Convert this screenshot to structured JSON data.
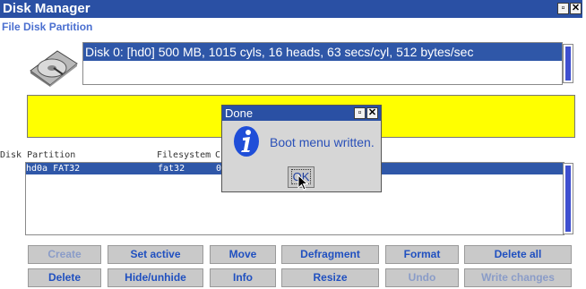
{
  "app": {
    "title": "Disk Manager",
    "menu_label": "File Disk Partition"
  },
  "disk": {
    "summary": "Disk 0: [hd0] 500 MB, 1015 cyls, 16 heads, 63 secs/cyl, 512 bytes/sec"
  },
  "partitions": {
    "headers": [
      "Disk Partition",
      "Filesystem",
      "C"
    ],
    "rows": [
      {
        "partition": "hd0a FAT32",
        "filesystem": "fat32",
        "c": "0"
      }
    ]
  },
  "buttons_row1": {
    "create": "Create",
    "set_active": "Set active",
    "move": "Move",
    "defragment": "Defragment",
    "format": "Format",
    "delete_all": "Delete all"
  },
  "buttons_row2": {
    "delete": "Delete",
    "hide_unhide": "Hide/unhide",
    "info": "Info",
    "resize": "Resize",
    "undo": "Undo",
    "write_changes": "Write changes"
  },
  "dialog": {
    "title": "Done",
    "message": "Boot menu written.",
    "ok_label": "OK",
    "icon": "info-icon"
  },
  "colors": {
    "titlebar": "#2a50a4",
    "selection": "#2f57a8",
    "highlight_panel": "#ffff00",
    "button_text": "#2050c0"
  }
}
